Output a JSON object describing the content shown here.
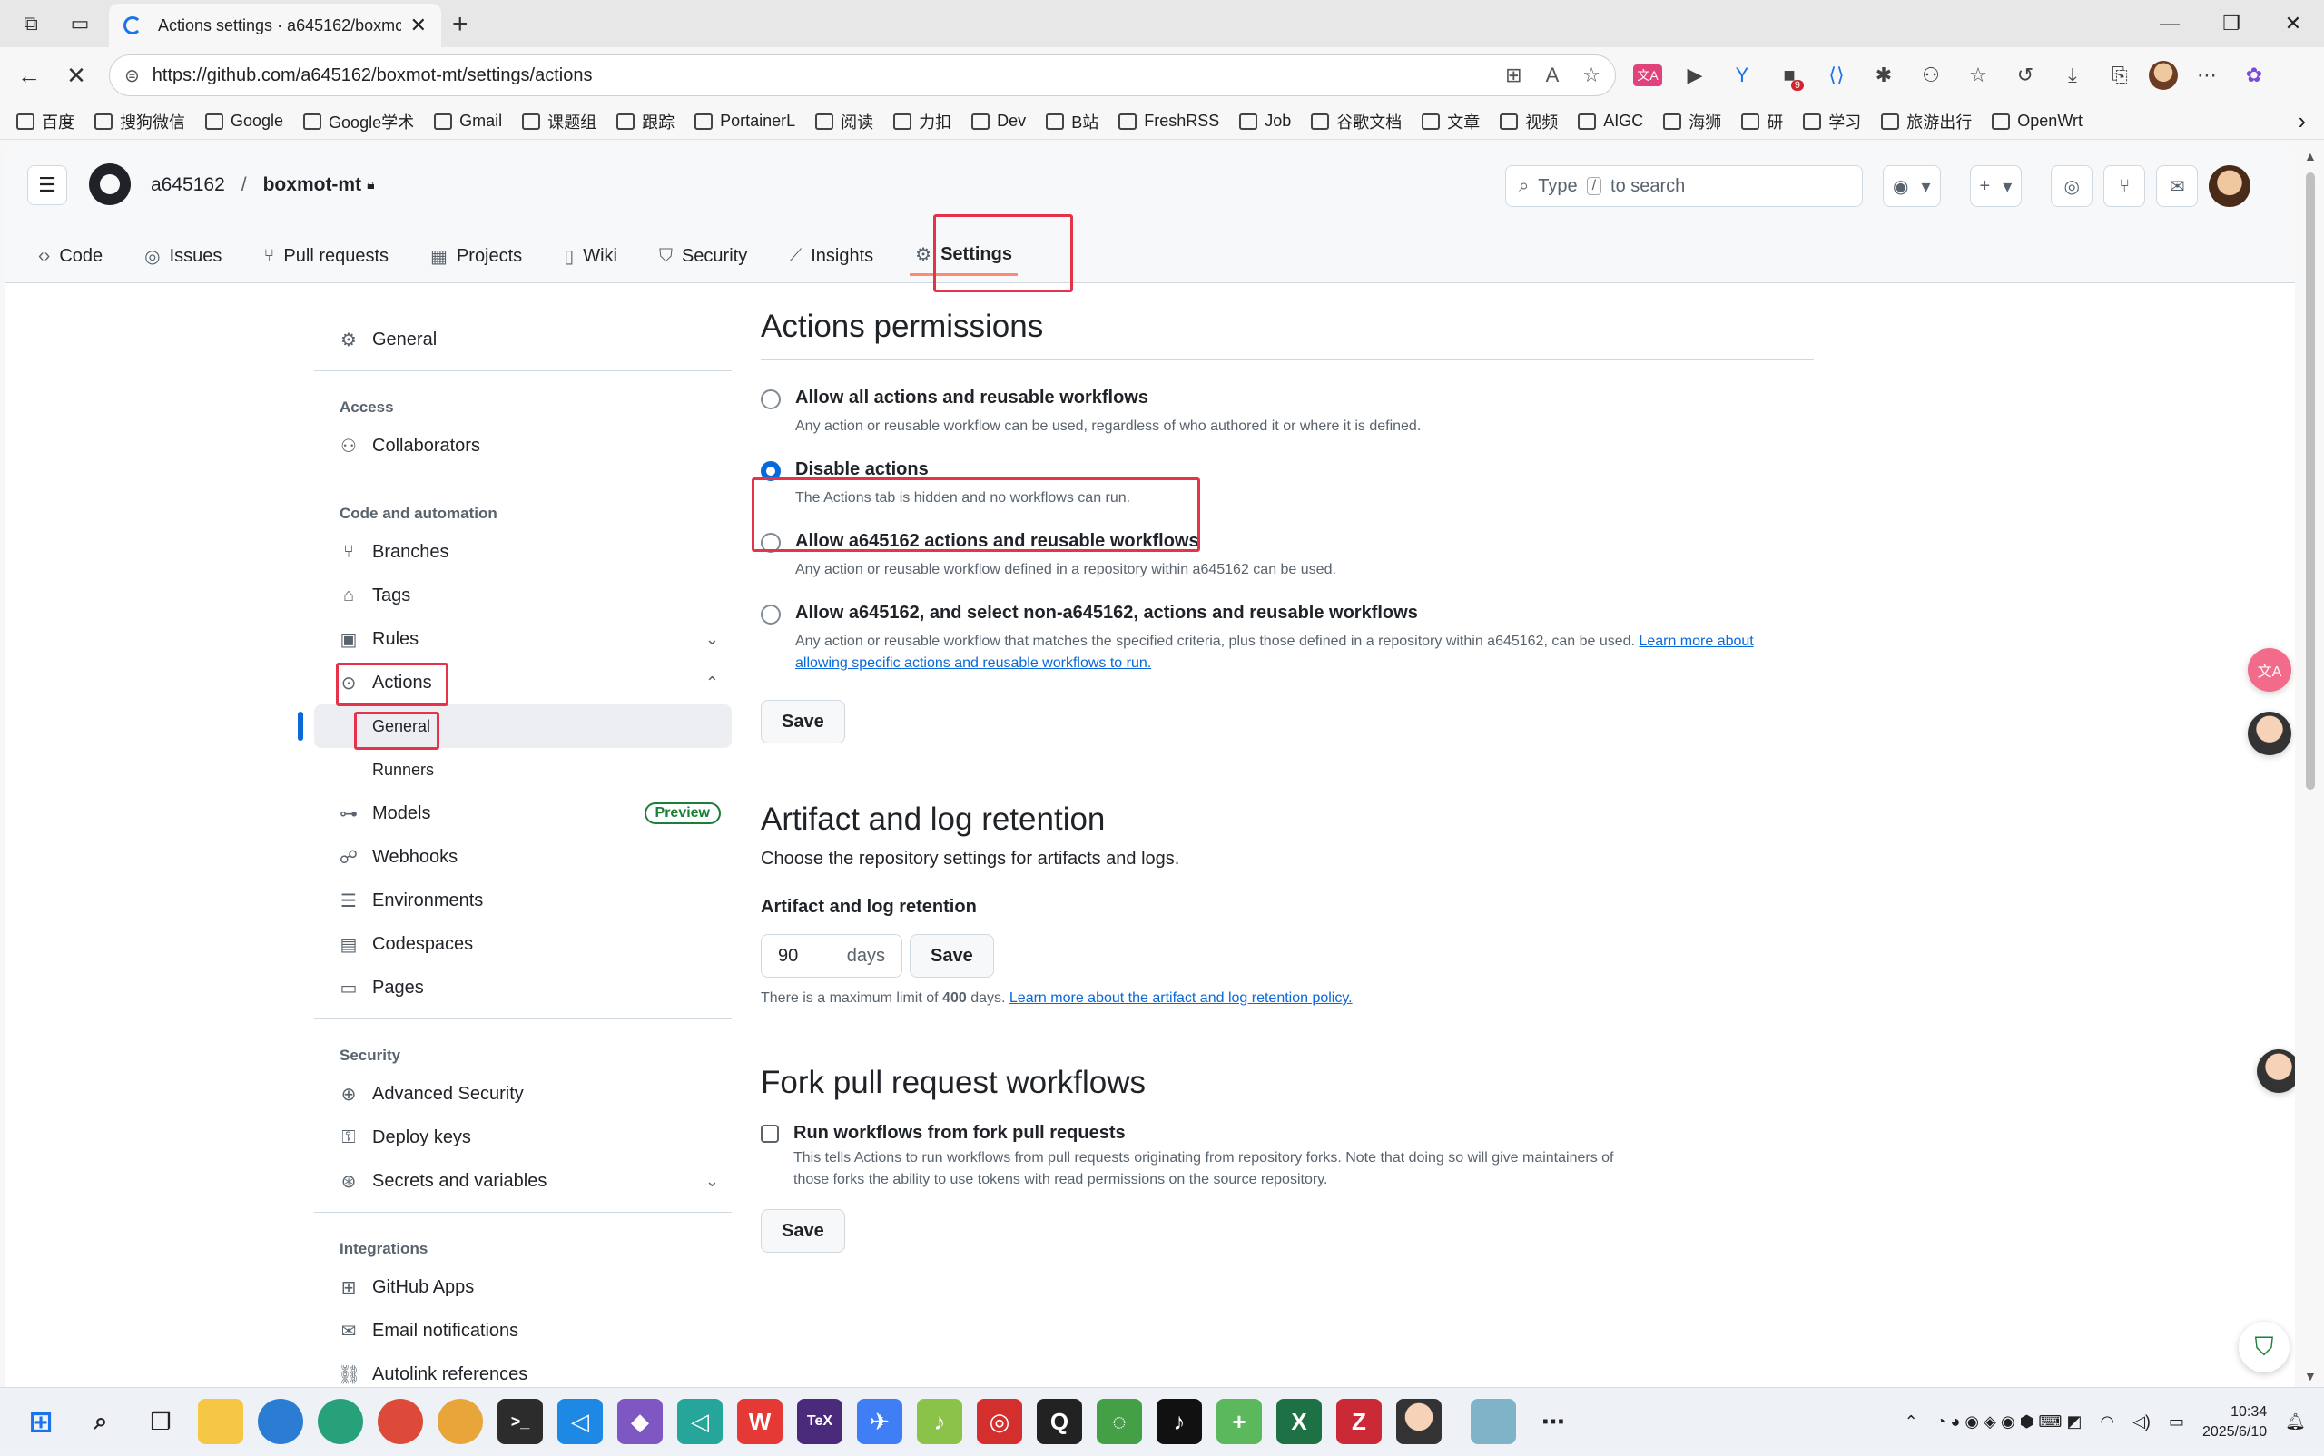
{
  "browser": {
    "tab_title": "Actions settings · a645162/boxmc",
    "url_host": "https://github.com",
    "url_path": "/a645162/boxmot-mt/settings/actions",
    "ext_badge": "9",
    "bookmarks": [
      "百度",
      "搜狗微信",
      "Google",
      "Google学术",
      "Gmail",
      "课题组",
      "跟踪",
      "PortainerL",
      "阅读",
      "力扣",
      "Dev",
      "B站",
      "FreshRSS",
      "Job",
      "谷歌文档",
      "文章",
      "视频",
      "AIGC",
      "海狮",
      "研",
      "学习",
      "旅游出行",
      "OpenWrt"
    ]
  },
  "header": {
    "owner": "a645162",
    "separator": "/",
    "repo": "boxmot-mt",
    "search_prefix": "Type",
    "search_key": "/",
    "search_suffix": "to search"
  },
  "repo_nav": [
    "Code",
    "Issues",
    "Pull requests",
    "Projects",
    "Wiki",
    "Security",
    "Insights",
    "Settings"
  ],
  "sidebar": {
    "general": "General",
    "access_head": "Access",
    "collaborators": "Collaborators",
    "code_head": "Code and automation",
    "branches": "Branches",
    "tags": "Tags",
    "rules": "Rules",
    "actions": "Actions",
    "actions_general": "General",
    "runners": "Runners",
    "models": "Models",
    "preview": "Preview",
    "webhooks": "Webhooks",
    "environments": "Environments",
    "codespaces": "Codespaces",
    "pages": "Pages",
    "security_head": "Security",
    "advanced_security": "Advanced Security",
    "deploy_keys": "Deploy keys",
    "secrets": "Secrets and variables",
    "integrations_head": "Integrations",
    "github_apps": "GitHub Apps",
    "email_notifications": "Email notifications",
    "autolink": "Autolink references"
  },
  "permissions": {
    "title": "Actions permissions",
    "options": [
      {
        "label": "Allow all actions and reusable workflows",
        "desc": "Any action or reusable workflow can be used, regardless of who authored it or where it is defined."
      },
      {
        "label": "Disable actions",
        "desc": "The Actions tab is hidden and no workflows can run."
      },
      {
        "label": "Allow a645162 actions and reusable workflows",
        "desc": "Any action or reusable workflow defined in a repository within a645162 can be used."
      },
      {
        "label": "Allow a645162, and select non-a645162, actions and reusable workflows",
        "desc": "Any action or reusable workflow that matches the specified criteria, plus those defined in a repository within a645162, can be used.",
        "link": "Learn more about allowing specific actions and reusable workflows to run."
      }
    ],
    "selected_index": 1,
    "save": "Save"
  },
  "retention": {
    "title": "Artifact and log retention",
    "desc": "Choose the repository settings for artifacts and logs.",
    "label": "Artifact and log retention",
    "value": "90",
    "unit": "days",
    "save": "Save",
    "note_prefix": "There is a maximum limit of",
    "note_max": "400",
    "note_mid": "days.",
    "note_link": "Learn more about the artifact and log retention policy."
  },
  "fork": {
    "title": "Fork pull request workflows",
    "check_label": "Run workflows from fork pull requests",
    "checked": false,
    "desc": "This tells Actions to run workflows from pull requests originating from repository forks. Note that doing so will give maintainers of those forks the ability to use tokens with read permissions on the source repository.",
    "save": "Save"
  },
  "taskbar": {
    "time": "10:34",
    "date": "2025/6/10"
  }
}
